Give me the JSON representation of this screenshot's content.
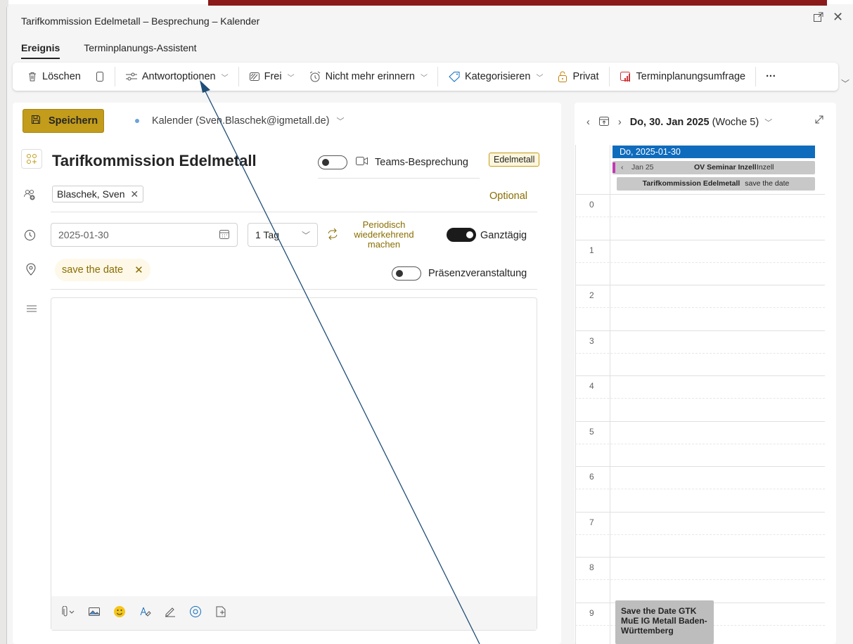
{
  "window": {
    "title": "Tarifkommission Edelmetall – Besprechung – Kalender"
  },
  "tabs": [
    "Ereignis",
    "Terminplanungs-Assistent"
  ],
  "toolbar": {
    "delete": "Löschen",
    "response_options": "Antwortoptionen",
    "show_as": "Frei",
    "reminder": "Nicht mehr erinnern",
    "categorize": "Kategorisieren",
    "private": "Privat",
    "poll": "Terminplanungsumfrage",
    "more": "···"
  },
  "form": {
    "save_label": "Speichern",
    "calendar": "Kalender (Sven.Blaschek@igmetall.de)",
    "title": "Tarifkommission Edelmetall",
    "teams_label": "Teams-Besprechung",
    "category_badge": "Edelmetall",
    "attendee": "Blaschek, Sven",
    "optional": "Optional",
    "date": "2025-01-30",
    "duration": "1 Tag",
    "recurring": "Periodisch wiederkehrend machen",
    "all_day_label": "Ganztägig",
    "all_day_on": true,
    "location": "save the date",
    "in_person_label": "Präsenzveranstaltung",
    "in_person_on": false,
    "teams_on": false
  },
  "calendar_pane": {
    "date_heading": "Do, 30. Jan 2025",
    "week": "(Woche 5)",
    "day_header": "Do, 2025-01-30",
    "all_day_events": [
      {
        "prefix": "Jan 25",
        "title": "OV Seminar Inzell",
        "location": "Inzell"
      },
      {
        "title": "Tarifkommission Edelmetall",
        "location": "save the date"
      }
    ],
    "hours": [
      "0",
      "1",
      "2",
      "3",
      "4",
      "5",
      "6",
      "7",
      "8",
      "9"
    ],
    "timed_event": "Save the Date GTK MuE IG Metall Baden-Württemberg"
  },
  "colors": {
    "accent_gold": "#c29c1a",
    "day_header_blue": "#0f6cbd",
    "arrow_blue": "#1f4e79"
  }
}
